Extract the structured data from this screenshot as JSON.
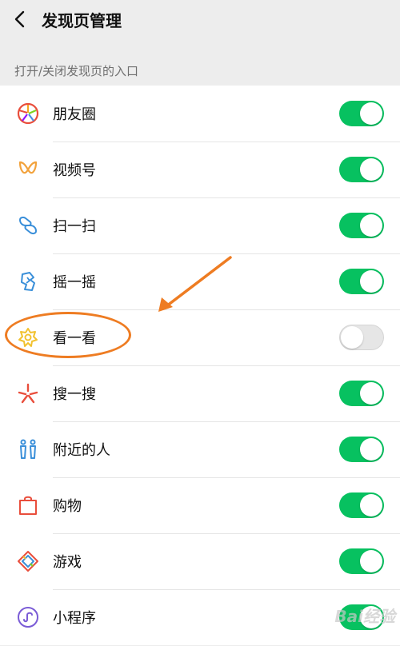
{
  "header": {
    "title": "发现页管理",
    "back_icon": "chevron-left-icon"
  },
  "section": {
    "label": "打开/关闭发现页的入口"
  },
  "items": [
    {
      "label": "朋友圈",
      "icon": "moments-icon",
      "enabled": true
    },
    {
      "label": "视频号",
      "icon": "channels-icon",
      "enabled": true
    },
    {
      "label": "扫一扫",
      "icon": "scan-icon",
      "enabled": true
    },
    {
      "label": "摇一摇",
      "icon": "shake-icon",
      "enabled": true
    },
    {
      "label": "看一看",
      "icon": "top-stories-icon",
      "enabled": false
    },
    {
      "label": "搜一搜",
      "icon": "search-icon",
      "enabled": true
    },
    {
      "label": "附近的人",
      "icon": "people-nearby-icon",
      "enabled": true
    },
    {
      "label": "购物",
      "icon": "shopping-icon",
      "enabled": true
    },
    {
      "label": "游戏",
      "icon": "games-icon",
      "enabled": true
    },
    {
      "label": "小程序",
      "icon": "mini-programs-icon",
      "enabled": true
    }
  ],
  "annotation": {
    "color": "#ee7c22"
  },
  "watermark": {
    "text": "Bai经验"
  },
  "colors": {
    "toggle_on": "#07c160",
    "toggle_off": "#e6e6e6",
    "background": "#ededed"
  }
}
